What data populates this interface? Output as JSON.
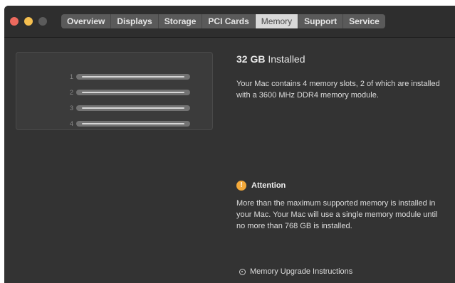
{
  "window": {
    "traffic_lights": [
      "close-icon",
      "minimize-icon",
      "zoom-icon"
    ],
    "colors": {
      "background": "#333333",
      "close": "#ed6a5e",
      "minimize": "#f5bf4f",
      "zoom": "#5b5b5b",
      "warning": "#f3a93a"
    }
  },
  "tabs": [
    {
      "label": "Overview",
      "active": false
    },
    {
      "label": "Displays",
      "active": false
    },
    {
      "label": "Storage",
      "active": false
    },
    {
      "label": "PCI Cards",
      "active": false
    },
    {
      "label": "Memory",
      "active": true
    },
    {
      "label": "Support",
      "active": false
    },
    {
      "label": "Service",
      "active": false
    }
  ],
  "memory": {
    "slots": [
      {
        "number": "1"
      },
      {
        "number": "2"
      },
      {
        "number": "3"
      },
      {
        "number": "4"
      }
    ],
    "installed_amount": "32 GB",
    "installed_label": "Installed",
    "description": "Your Mac contains 4 memory slots, 2 of which are installed with a 3600 MHz DDR4 memory module.",
    "attention_title": "Attention",
    "attention_icon": "warning-icon",
    "attention_text": "More than the maximum supported memory is installed in your Mac. Your Mac will use a single memory module until no more than 768 GB is installed.",
    "upgrade_link": "Memory Upgrade Instructions",
    "upgrade_icon": "help-ring-icon"
  }
}
